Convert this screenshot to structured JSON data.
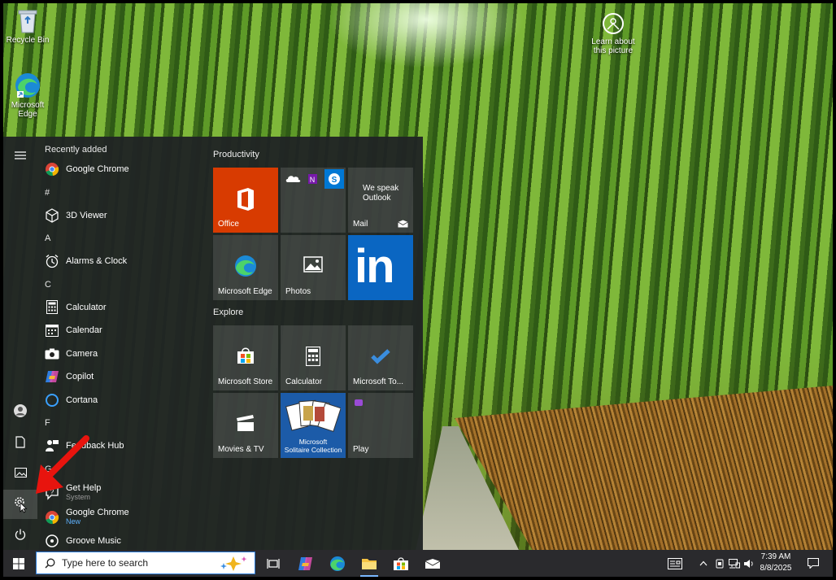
{
  "desktop": {
    "icons": [
      {
        "label": "Recycle Bin",
        "icon": "recycle-bin-icon"
      },
      {
        "label": "Microsoft Edge",
        "icon": "edge-icon"
      }
    ],
    "learn_line1": "Learn about",
    "learn_line2": "this picture"
  },
  "start_menu": {
    "recently_added_header": "Recently added",
    "apps": {
      "recent_chrome": "Google Chrome",
      "hash_section": "#",
      "viewer3d": "3D Viewer",
      "a_section": "A",
      "alarms": "Alarms & Clock",
      "c_section": "C",
      "calculator": "Calculator",
      "calendar": "Calendar",
      "camera": "Camera",
      "copilot": "Copilot",
      "cortana": "Cortana",
      "f_section": "F",
      "feedback": "Feedback Hub",
      "g_section": "G",
      "gethelp": "Get Help",
      "gethelp_sub": "System",
      "chrome": "Google Chrome",
      "chrome_sub": "New",
      "groove": "Groove Music"
    },
    "groups": {
      "productivity": "Productivity",
      "explore": "Explore"
    },
    "tiles": {
      "office": "Office",
      "mail_text1": "We speak",
      "mail_text2": "Outlook",
      "mail": "Mail",
      "edge": "Microsoft Edge",
      "photos": "Photos",
      "linkedin_text": "in",
      "store": "Microsoft Store",
      "calculator": "Calculator",
      "todo": "Microsoft To...",
      "movies": "Movies & TV",
      "solitaire1": "Microsoft",
      "solitaire2": "Solitaire Collection",
      "play": "Play"
    }
  },
  "taskbar": {
    "search_placeholder": "Type here to search",
    "time": "7:39 AM",
    "date": "8/8/2025"
  },
  "colors": {
    "office_tile": "#d83b01",
    "linkedin_tile": "#0a66c2",
    "accent": "#0078d4",
    "annotation_arrow": "#e8140e"
  }
}
